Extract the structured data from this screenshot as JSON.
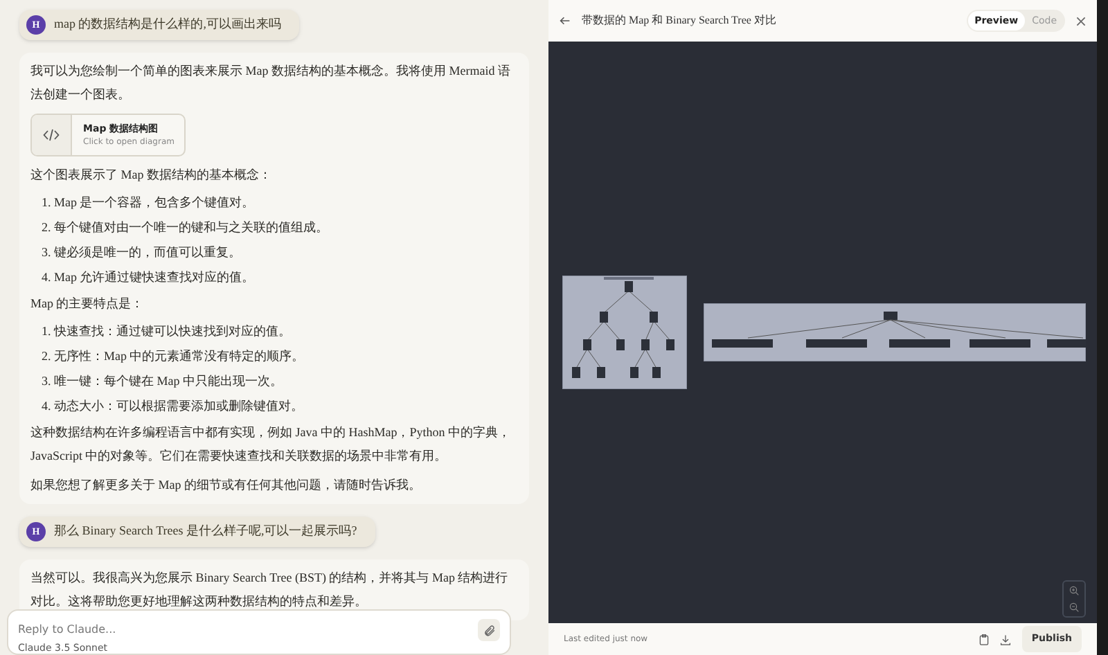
{
  "conversation": [
    {
      "kind": "user",
      "avatar": "H",
      "text": "map 的数据结构是什么样的,可以画出来吗"
    },
    {
      "kind": "assistant",
      "blocks": [
        {
          "kind": "paragraph",
          "text": "我可以为您绘制一个简单的图表来展示 Map 数据结构的基本概念。我将使用 Mermaid 语法创建一个图表。"
        },
        {
          "kind": "artifact",
          "title": "Map 数据结构图",
          "subtitle": "Click to open diagram"
        },
        {
          "kind": "paragraph",
          "text": "这个图表展示了 Map 数据结构的基本概念："
        },
        {
          "kind": "list",
          "items": [
            "1. Map 是一个容器，包含多个键值对。",
            "2. 每个键值对由一个唯一的键和与之关联的值组成。",
            "3. 键必须是唯一的，而值可以重复。",
            "4. Map 允许通过键快速查找对应的值。"
          ]
        },
        {
          "kind": "paragraph",
          "text": "Map 的主要特点是："
        },
        {
          "kind": "list",
          "items": [
            "1. 快速查找：通过键可以快速找到对应的值。",
            "2. 无序性：Map 中的元素通常没有特定的顺序。",
            "3. 唯一键：每个键在 Map 中只能出现一次。",
            "4. 动态大小：可以根据需要添加或删除键值对。"
          ]
        },
        {
          "kind": "paragraph",
          "text": "这种数据结构在许多编程语言中都有实现，例如 Java 中的 HashMap，Python 中的字典，JavaScript 中的对象等。它们在需要快速查找和关联数据的场景中非常有用。"
        },
        {
          "kind": "paragraph",
          "text": "如果您想了解更多关于 Map 的细节或有任何其他问题，请随时告诉我。"
        }
      ]
    },
    {
      "kind": "user",
      "avatar": "H",
      "text": "那么 Binary Search Trees 是什么样子呢,可以一起展示吗?"
    },
    {
      "kind": "assistant",
      "blocks": [
        {
          "kind": "paragraph",
          "text": "当然可以。我很高兴为您展示 Binary Search Tree (BST) 的结构，并将其与 Map 结构进行对比。这将帮助您更好地理解这两种数据结构的特点和差异。"
        }
      ]
    }
  ],
  "composer": {
    "placeholder": "Reply to Claude...",
    "model": "Claude 3.5 Sonnet"
  },
  "artifact_panel": {
    "title": "带数据的 Map 和 Binary Search Tree 对比",
    "tabs": [
      {
        "label": "Preview",
        "selected": true
      },
      {
        "label": "Code",
        "selected": false
      }
    ],
    "footer": {
      "status": "Last edited just now",
      "publish": "Publish"
    }
  }
}
